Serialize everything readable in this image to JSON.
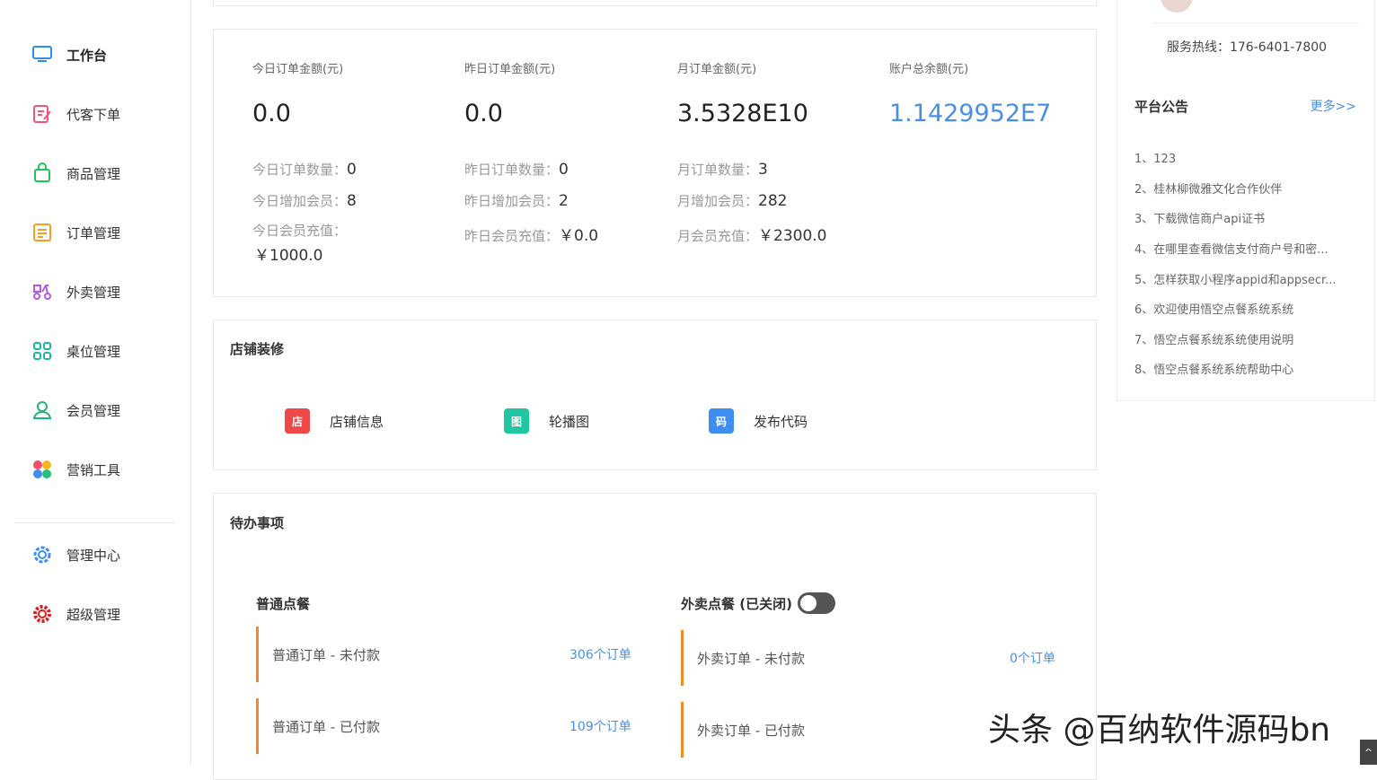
{
  "sidebar": {
    "items": [
      {
        "label": "工作台",
        "icon": "monitor-icon"
      },
      {
        "label": "代客下单",
        "icon": "edit-order-icon"
      },
      {
        "label": "商品管理",
        "icon": "bag-icon"
      },
      {
        "label": "订单管理",
        "icon": "list-icon"
      },
      {
        "label": "外卖管理",
        "icon": "scooter-icon"
      },
      {
        "label": "桌位管理",
        "icon": "grid-icon"
      },
      {
        "label": "会员管理",
        "icon": "user-icon"
      },
      {
        "label": "营销工具",
        "icon": "petals-icon"
      },
      {
        "label": "管理中心",
        "icon": "gear-icon"
      },
      {
        "label": "超级管理",
        "icon": "cog-red-icon"
      }
    ]
  },
  "stats": {
    "today": {
      "title": "今日订单金额(元)",
      "amount": "0.0",
      "lines": [
        {
          "k": "今日订单数量：",
          "v": "0"
        },
        {
          "k": "今日增加会员：",
          "v": "8"
        }
      ],
      "recharge_label": "今日会员充值：",
      "recharge_value": "￥1000.0"
    },
    "yesterday": {
      "title": "昨日订单金额(元)",
      "amount": "0.0",
      "lines": [
        {
          "k": "昨日订单数量：",
          "v": "0"
        },
        {
          "k": "昨日增加会员：",
          "v": "2"
        },
        {
          "k": "昨日会员充值：",
          "v": "￥0.0"
        }
      ]
    },
    "month": {
      "title": "月订单金额(元)",
      "amount": "3.5328E10",
      "lines": [
        {
          "k": "月订单数量：",
          "v": "3"
        },
        {
          "k": "月增加会员：",
          "v": "282"
        },
        {
          "k": "月会员充值：",
          "v": "￥2300.0"
        }
      ]
    },
    "balance": {
      "title": "账户总余额(元)",
      "amount": "1.1429952E7"
    }
  },
  "shop": {
    "title": "店铺装修",
    "buttons": [
      {
        "badge": "店",
        "label": "店铺信息",
        "color": "#f04848"
      },
      {
        "badge": "图",
        "label": "轮播图",
        "color": "#1fc7a0"
      },
      {
        "badge": "码",
        "label": "发布代码",
        "color": "#3d8ef0"
      }
    ]
  },
  "todo": {
    "title": "待办事项",
    "normal": {
      "head": "普通点餐",
      "rows": [
        {
          "label": "普通订单 - 未付款",
          "count": "306个订单"
        },
        {
          "label": "普通订单 - 已付款",
          "count": "109个订单"
        }
      ]
    },
    "takeout": {
      "head": "外卖点餐 (已关闭)",
      "toggle_on": false,
      "rows": [
        {
          "label": "外卖订单 - 未付款",
          "count": "0个订单"
        },
        {
          "label": "外卖订单 - 已付款",
          "count": ""
        }
      ]
    }
  },
  "right": {
    "hotline": "服务热线：176-6401-7800",
    "notice_title": "平台公告",
    "more": "更多>>",
    "notices": [
      "1、123",
      "2、桂林柳微雅文化合作伙伴",
      "3、下载微信商户api证书",
      "4、在哪里查看微信支付商户号和密...",
      "5、怎样获取小程序appid和appsecr...",
      "6、欢迎使用悟空点餐系统系统",
      "7、悟空点餐系统系统使用说明",
      "8、悟空点餐系统系统帮助中心"
    ]
  },
  "watermark": "头条 @百纳软件源码bn",
  "scroll_top": "^"
}
